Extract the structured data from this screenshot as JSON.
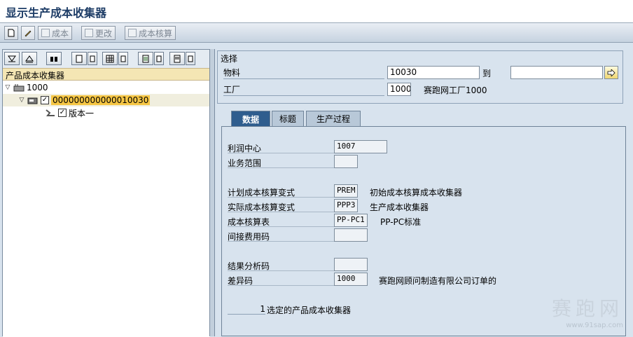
{
  "window": {
    "title": "显示生产成本收集器"
  },
  "toolbar": {
    "cost_label": "成本",
    "change_label": "更改",
    "costing_label": "成本核算"
  },
  "tree": {
    "header": "产品成本收集器",
    "root_label": "1000",
    "collector_id": "000000000000010030",
    "version_label": "版本一"
  },
  "selection": {
    "caption": "选择",
    "material_label": "物料",
    "material_value": "10030",
    "to_label": "到",
    "material_to_value": "",
    "plant_label": "工厂",
    "plant_value": "1000",
    "plant_desc": "赛跑网工厂1000"
  },
  "tabs": [
    {
      "label": "数据"
    },
    {
      "label": "标题"
    },
    {
      "label": "生产过程"
    }
  ],
  "data_tab": {
    "profit_center_label": "利润中心",
    "profit_center_value": "1007",
    "business_area_label": "业务范围",
    "business_area_value": "",
    "planned_variant_label": "计划成本核算变式",
    "planned_variant_value": "PREM",
    "planned_variant_desc": "初始成本核算成本收集器",
    "actual_variant_label": "实际成本核算变式",
    "actual_variant_value": "PPP3",
    "actual_variant_desc": "生产成本收集器",
    "costing_sheet_label": "成本核算表",
    "costing_sheet_value": "PP-PC1",
    "costing_sheet_desc": "PP-PC标准",
    "overhead_key_label": "间接费用码",
    "overhead_key_value": "",
    "result_analysis_label": "结果分析码",
    "result_analysis_value": "",
    "variance_key_label": "差异码",
    "variance_key_value": "1000",
    "variance_key_desc": "赛跑网顾问制造有限公司订单的",
    "selected_count": "1",
    "selected_text": "选定的产品成本收集器"
  },
  "watermark": {
    "text": "赛跑网",
    "url": "www.91sap.com"
  }
}
